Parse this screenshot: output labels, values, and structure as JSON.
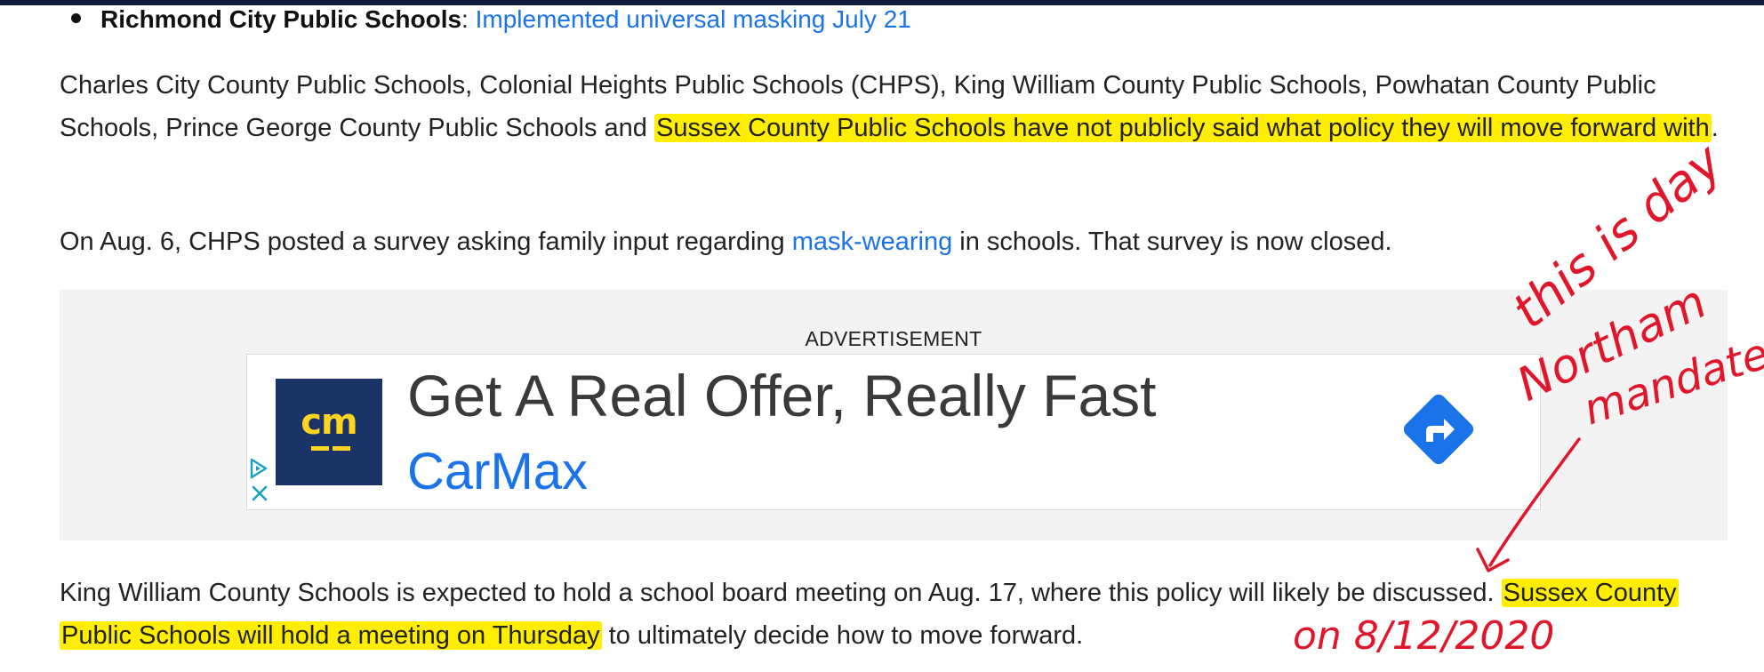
{
  "bullet": {
    "district": "Richmond City Public Schools",
    "colon": ":",
    "link": "Implemented universal masking July 21"
  },
  "paragraph1": {
    "pre": "Charles City County Public Schools, Colonial Heights Public Schools (CHPS), King William County Public Schools, Powhatan County Public Schools, Prince George County Public Schools and ",
    "highlight": "Sussex County Public Schools have not publicly said what policy they will move forward with",
    "post": "."
  },
  "paragraph2": {
    "pre": "On Aug. 6, CHPS posted a survey asking family input regarding ",
    "link": "mask-wearing",
    "post": " in schools. That survey is now closed."
  },
  "advertisement": {
    "label": "ADVERTISEMENT",
    "headline": "Get A Real Offer, Really Fast",
    "brand": "CarMax",
    "logo_text": "cm",
    "icons": [
      "adchoices-icon",
      "close-icon",
      "directions-arrow-icon"
    ]
  },
  "paragraph3": {
    "pre": "King William County Schools is expected to hold a school board meeting on Aug. 17, where this policy will likely be discussed. ",
    "highlight": "Sussex County Public Schools will hold a meeting on Thursday",
    "post": " to ultimately decide how to move forward."
  },
  "annotations": {
    "line1": "this is day",
    "line2": "Northam",
    "line3": "mandates",
    "date": "on  8/12/2020"
  },
  "colors": {
    "link": "#1a73e8",
    "highlight": "#ffee00",
    "annotation": "#e0162b",
    "top_bar": "#0f1b3d",
    "logo_bg": "#1a3468",
    "logo_text": "#ffd520"
  }
}
